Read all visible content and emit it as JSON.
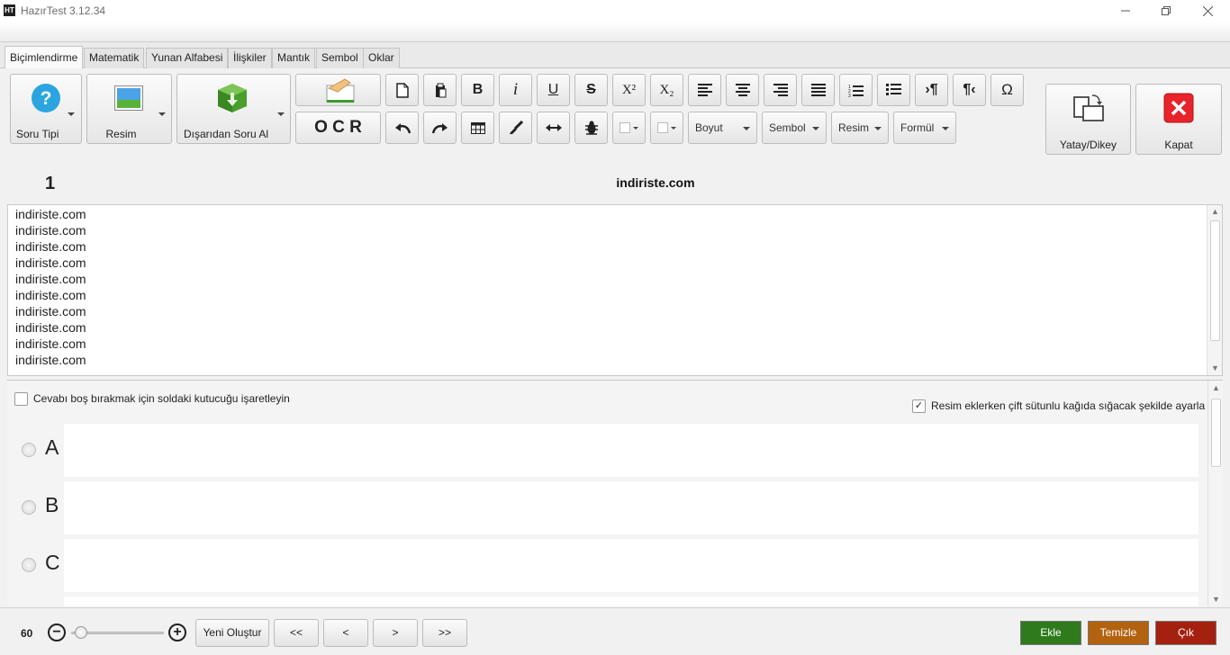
{
  "window": {
    "title": "HazırTest 3.12.34",
    "icon_text": "HT",
    "minimize_icon": "minimize-icon",
    "restore_icon": "restore-icon",
    "close_icon": "close-icon"
  },
  "tabs": [
    {
      "label": "Biçimlendirme",
      "active": true
    },
    {
      "label": "Matematik"
    },
    {
      "label": "Yunan Alfabesi"
    },
    {
      "label": "İlişkiler"
    },
    {
      "label": "Mantık"
    },
    {
      "label": "Sembol"
    },
    {
      "label": "Oklar"
    }
  ],
  "toolbar": {
    "soru_tipi_label": "Soru Tipi",
    "resim_label": "Resim",
    "disaridan_label": "Dışarıdan Soru Al",
    "ocr_label": "O C R",
    "boyut_label": "Boyut",
    "sembol_label": "Sembol",
    "resim_dd_label": "Resim",
    "formul_label": "Formül",
    "yatay_dikey_label": "Yatay/Dikey",
    "kapat_label": "Kapat",
    "bold_glyph": "B",
    "italic_glyph": "i",
    "underline_glyph": "U",
    "strike_glyph": "S",
    "superscript_glyph": "X²",
    "subscript_glyph": "X₂",
    "omega_glyph": "Ω",
    "ltr_glyph": "›¶",
    "rtl_glyph": "¶‹",
    "soru_tipi_glyph": "?",
    "colors": {
      "kapat_red": "#e8232a",
      "help_blue": "#2aa5e0",
      "package_green": "#4a9e2c"
    }
  },
  "question": {
    "number": "1",
    "title": "indiriste.com",
    "lines": [
      "indiriste.com",
      "indiriste.com",
      "indiriste.com",
      "indiriste.com",
      "indiriste.com",
      "indiriste.com",
      "indiriste.com",
      "indiriste.com",
      "indiriste.com",
      "indiriste.com"
    ]
  },
  "options": {
    "leave_blank_label": "Cevabı boş bırakmak için soldaki kutucuğu işaretleyin",
    "leave_blank_checked": false,
    "fit_images_label": "Resim eklerken çift sütunlu kağıda sığacak şekilde ayarla",
    "fit_images_checked": true,
    "check_glyph": "✓",
    "answers": [
      "A",
      "B",
      "C"
    ]
  },
  "bottom": {
    "zoom_value": "60",
    "zoom_fraction": 0.05,
    "zoom_out_glyph": "−",
    "zoom_in_glyph": "+",
    "yeni_olustur": "Yeni Oluştur",
    "first": "<<",
    "prev": "<",
    "next": ">",
    "last": ">>",
    "ekle": "Ekle",
    "temizle": "Temizle",
    "cik": "Çık",
    "colors": {
      "ekle": "#2f7a1c",
      "temizle": "#b3620f",
      "cik": "#a4210f"
    }
  }
}
